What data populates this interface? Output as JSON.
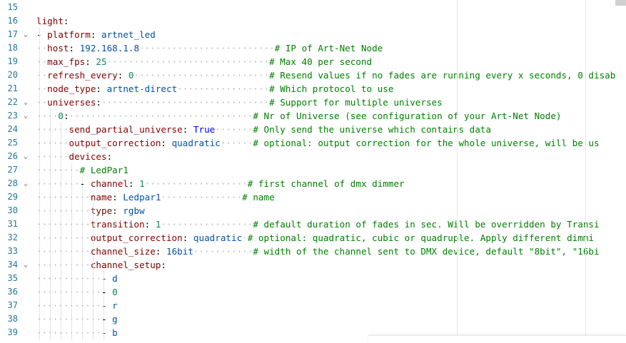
{
  "editor": {
    "lines": [
      {
        "num": "15",
        "fold": "",
        "tokens": []
      },
      {
        "num": "16",
        "fold": "",
        "tokens": [
          {
            "t": "k",
            "s": "light"
          },
          {
            "t": "p",
            "s": ":"
          }
        ]
      },
      {
        "num": "17",
        "fold": "⌄",
        "tokens": [
          {
            "t": "p",
            "s": "- "
          },
          {
            "t": "k",
            "s": "platform"
          },
          {
            "t": "p",
            "s": ": "
          },
          {
            "t": "v",
            "s": "artnet_led"
          }
        ]
      },
      {
        "num": "18",
        "fold": "",
        "tokens": [
          {
            "t": "d",
            "s": "··"
          },
          {
            "t": "k",
            "s": "host"
          },
          {
            "t": "p",
            "s": ": "
          },
          {
            "t": "v",
            "s": "192.168.1.8"
          },
          {
            "t": "d",
            "s": "·························"
          },
          {
            "t": "c",
            "s": "# IP of Art-Net Node"
          }
        ]
      },
      {
        "num": "19",
        "fold": "",
        "tokens": [
          {
            "t": "d",
            "s": "··"
          },
          {
            "t": "k",
            "s": "max_fps"
          },
          {
            "t": "p",
            "s": ": "
          },
          {
            "t": "n",
            "s": "25"
          },
          {
            "t": "d",
            "s": "······························"
          },
          {
            "t": "c",
            "s": "# Max 40 per second"
          }
        ]
      },
      {
        "num": "20",
        "fold": "",
        "tokens": [
          {
            "t": "d",
            "s": "··"
          },
          {
            "t": "k",
            "s": "refresh_every"
          },
          {
            "t": "p",
            "s": ": "
          },
          {
            "t": "n",
            "s": "0"
          },
          {
            "t": "d",
            "s": "·························"
          },
          {
            "t": "c",
            "s": "# Resend values if no fades are running every x seconds, 0 disab"
          }
        ]
      },
      {
        "num": "21",
        "fold": "",
        "tokens": [
          {
            "t": "d",
            "s": "··"
          },
          {
            "t": "k",
            "s": "node_type"
          },
          {
            "t": "p",
            "s": ": "
          },
          {
            "t": "v",
            "s": "artnet-direct"
          },
          {
            "t": "d",
            "s": "·················"
          },
          {
            "t": "c",
            "s": "# Which protocol to use"
          }
        ]
      },
      {
        "num": "22",
        "fold": "⌄",
        "tokens": [
          {
            "t": "d",
            "s": "··"
          },
          {
            "t": "k",
            "s": "universes"
          },
          {
            "t": "p",
            "s": ":"
          },
          {
            "t": "d",
            "s": "·······························"
          },
          {
            "t": "c",
            "s": "# Support for multiple universes"
          }
        ]
      },
      {
        "num": "23",
        "fold": "⌄",
        "tokens": [
          {
            "t": "d",
            "s": "····"
          },
          {
            "t": "n",
            "s": "0"
          },
          {
            "t": "p",
            "s": ":"
          },
          {
            "t": "d",
            "s": "··································"
          },
          {
            "t": "c",
            "s": "# Nr of Universe (see configuration of your Art-Net Node)"
          }
        ]
      },
      {
        "num": "24",
        "fold": "",
        "tokens": [
          {
            "t": "d",
            "s": "······"
          },
          {
            "t": "k",
            "s": "send_partial_universe"
          },
          {
            "t": "p",
            "s": ": "
          },
          {
            "t": "b",
            "s": "True"
          },
          {
            "t": "d",
            "s": "·······"
          },
          {
            "t": "c",
            "s": "# Only send the universe which contains data"
          }
        ]
      },
      {
        "num": "25",
        "fold": "",
        "tokens": [
          {
            "t": "d",
            "s": "······"
          },
          {
            "t": "k",
            "s": "output_correction"
          },
          {
            "t": "p",
            "s": ": "
          },
          {
            "t": "v",
            "s": "quadratic"
          },
          {
            "t": "d",
            "s": "······"
          },
          {
            "t": "c",
            "s": "# optional: output correction for the whole universe, will be us"
          }
        ]
      },
      {
        "num": "26",
        "fold": "⌄",
        "tokens": [
          {
            "t": "d",
            "s": "······"
          },
          {
            "t": "k",
            "s": "devices"
          },
          {
            "t": "p",
            "s": ":"
          }
        ]
      },
      {
        "num": "27",
        "fold": "",
        "tokens": [
          {
            "t": "d",
            "s": "········"
          },
          {
            "t": "c",
            "s": "# LedPar1"
          }
        ]
      },
      {
        "num": "28",
        "fold": "⌄",
        "tokens": [
          {
            "t": "d",
            "s": "········"
          },
          {
            "t": "p",
            "s": "- "
          },
          {
            "t": "k",
            "s": "channel"
          },
          {
            "t": "p",
            "s": ": "
          },
          {
            "t": "n",
            "s": "1"
          },
          {
            "t": "d",
            "s": "···················"
          },
          {
            "t": "c",
            "s": "# first channel of dmx dimmer"
          }
        ]
      },
      {
        "num": "29",
        "fold": "",
        "tokens": [
          {
            "t": "d",
            "s": "··········"
          },
          {
            "t": "k",
            "s": "name"
          },
          {
            "t": "p",
            "s": ": "
          },
          {
            "t": "v",
            "s": "Ledpar1"
          },
          {
            "t": "d",
            "s": "···············"
          },
          {
            "t": "c",
            "s": "# name"
          }
        ]
      },
      {
        "num": "30",
        "fold": "",
        "tokens": [
          {
            "t": "d",
            "s": "··········"
          },
          {
            "t": "k",
            "s": "type"
          },
          {
            "t": "p",
            "s": ": "
          },
          {
            "t": "v",
            "s": "rgbw"
          }
        ]
      },
      {
        "num": "31",
        "fold": "",
        "tokens": [
          {
            "t": "d",
            "s": "··········"
          },
          {
            "t": "k",
            "s": "transition"
          },
          {
            "t": "p",
            "s": ": "
          },
          {
            "t": "n",
            "s": "1"
          },
          {
            "t": "d",
            "s": "·················"
          },
          {
            "t": "c",
            "s": "# default duration of fades in sec. Will be overridden by Transi"
          }
        ]
      },
      {
        "num": "32",
        "fold": "",
        "tokens": [
          {
            "t": "d",
            "s": "··········"
          },
          {
            "t": "k",
            "s": "output_correction"
          },
          {
            "t": "p",
            "s": ": "
          },
          {
            "t": "v",
            "s": "quadratic"
          },
          {
            "t": "d",
            "s": "·"
          },
          {
            "t": "c",
            "s": "# optional: quadratic, cubic or quadruple. Apply different dimmi"
          }
        ]
      },
      {
        "num": "33",
        "fold": "",
        "tokens": [
          {
            "t": "d",
            "s": "··········"
          },
          {
            "t": "k",
            "s": "channel_size"
          },
          {
            "t": "p",
            "s": ": "
          },
          {
            "t": "v",
            "s": "16bit"
          },
          {
            "t": "d",
            "s": "···········"
          },
          {
            "t": "c",
            "s": "# width of the channel sent to DMX device, default \"8bit\", \"16bi"
          }
        ]
      },
      {
        "num": "34",
        "fold": "⌄",
        "tokens": [
          {
            "t": "d",
            "s": "··········"
          },
          {
            "t": "k",
            "s": "channel_setup"
          },
          {
            "t": "p",
            "s": ":"
          }
        ]
      },
      {
        "num": "35",
        "fold": "",
        "tokens": [
          {
            "t": "d",
            "s": "············"
          },
          {
            "t": "p",
            "s": "- "
          },
          {
            "t": "v",
            "s": "d"
          }
        ]
      },
      {
        "num": "36",
        "fold": "",
        "tokens": [
          {
            "t": "d",
            "s": "············"
          },
          {
            "t": "p",
            "s": "- "
          },
          {
            "t": "n",
            "s": "0"
          }
        ]
      },
      {
        "num": "37",
        "fold": "",
        "tokens": [
          {
            "t": "d",
            "s": "············"
          },
          {
            "t": "p",
            "s": "- "
          },
          {
            "t": "v",
            "s": "r"
          }
        ]
      },
      {
        "num": "38",
        "fold": "",
        "tokens": [
          {
            "t": "d",
            "s": "············"
          },
          {
            "t": "p",
            "s": "- "
          },
          {
            "t": "v",
            "s": "g"
          }
        ]
      },
      {
        "num": "39",
        "fold": "",
        "tokens": [
          {
            "t": "d",
            "s": "············"
          },
          {
            "t": "p",
            "s": "- "
          },
          {
            "t": "v",
            "s": "b"
          }
        ]
      }
    ]
  }
}
